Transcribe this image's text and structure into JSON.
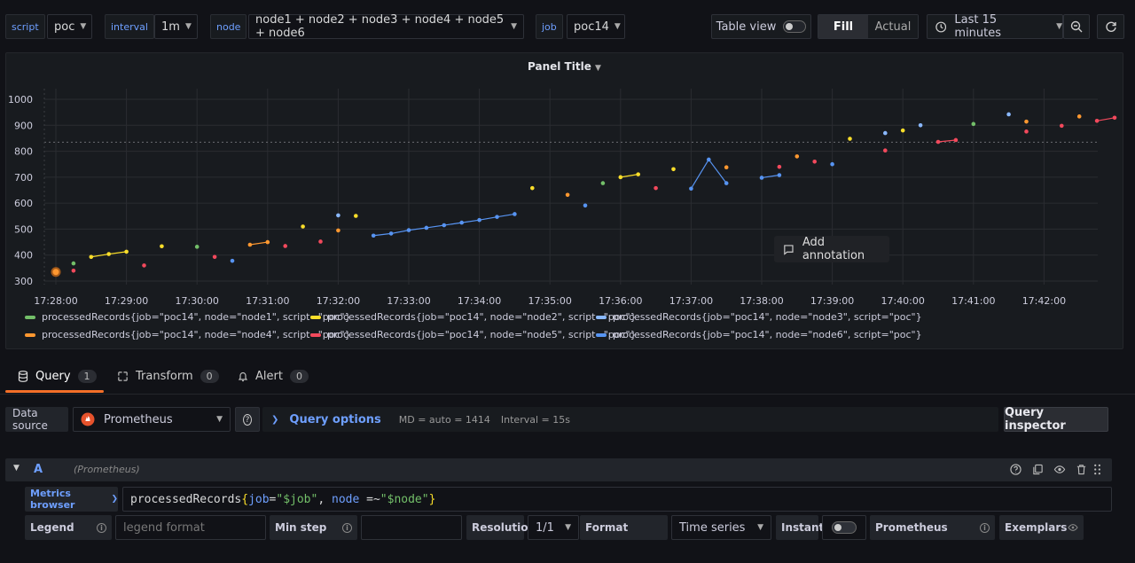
{
  "variables": [
    {
      "label": "script",
      "value": "poc"
    },
    {
      "label": "interval",
      "value": "1m"
    },
    {
      "label": "node",
      "value": "node1 + node2 + node3 + node4 + node5 + node6"
    },
    {
      "label": "job",
      "value": "poc14"
    }
  ],
  "toolbar": {
    "table_view": "Table view",
    "fill": "Fill",
    "actual": "Actual",
    "time_range": "Last 15 minutes"
  },
  "panel": {
    "title": "Panel Title",
    "annotation": "Add annotation"
  },
  "chart_data": {
    "type": "scatter",
    "title": "Panel Title",
    "y_ticks": [
      1000,
      900,
      800,
      700,
      600,
      500,
      400,
      300
    ],
    "ylim": [
      290,
      1010
    ],
    "x_ticks": [
      "17:28:00",
      "17:29:00",
      "17:30:00",
      "17:31:00",
      "17:32:00",
      "17:33:00",
      "17:34:00",
      "17:35:00",
      "17:36:00",
      "17:37:00",
      "17:38:00",
      "17:39:00",
      "17:40:00",
      "17:41:00",
      "17:42:00"
    ],
    "threshold": 835,
    "series": [
      {
        "name": "processedRecords{job=\"poc14\", node=\"node1\", script=\"poc\"}",
        "color": "#73bf69",
        "points": [
          [
            "17:28:15",
            368
          ],
          [
            "17:30:00",
            432
          ],
          [
            "17:35:45",
            677
          ],
          [
            "17:41:00",
            905
          ]
        ]
      },
      {
        "name": "processedRecords{job=\"poc14\", node=\"node2\", script=\"poc\"}",
        "color": "#fade2a",
        "points": [
          [
            "17:28:30",
            393
          ],
          [
            "17:28:45",
            404
          ],
          [
            "17:29:00",
            413
          ],
          [
            "17:29:30",
            434
          ],
          [
            "17:31:30",
            510
          ],
          [
            "17:32:15",
            551
          ],
          [
            "17:34:45",
            658
          ],
          [
            "17:36:00",
            700
          ],
          [
            "17:36:15",
            711
          ],
          [
            "17:36:45",
            731
          ],
          [
            "17:39:15",
            848
          ],
          [
            "17:40:00",
            880
          ]
        ]
      },
      {
        "name": "processedRecords{job=\"poc14\", node=\"node3\", script=\"poc\"}",
        "color": "#8ab8ff",
        "points": [
          [
            "17:32:00",
            553
          ],
          [
            "17:39:45",
            870
          ],
          [
            "17:40:15",
            900
          ],
          [
            "17:41:30",
            942
          ]
        ]
      },
      {
        "name": "processedRecords{job=\"poc14\", node=\"node4\", script=\"poc\"}",
        "color": "#ff9830",
        "points": [
          [
            "17:28:00",
            335
          ],
          [
            "17:30:45",
            440
          ],
          [
            "17:31:00",
            450
          ],
          [
            "17:32:00",
            495
          ],
          [
            "17:35:15",
            632
          ],
          [
            "17:37:30",
            738
          ],
          [
            "17:38:30",
            780
          ],
          [
            "17:41:45",
            914
          ],
          [
            "17:42:30",
            934
          ]
        ]
      },
      {
        "name": "processedRecords{job=\"poc14\", node=\"node5\", script=\"poc\"}",
        "color": "#f2495c",
        "points": [
          [
            "17:28:15",
            340
          ],
          [
            "17:29:15",
            360
          ],
          [
            "17:30:15",
            393
          ],
          [
            "17:31:15",
            435
          ],
          [
            "17:31:45",
            452
          ],
          [
            "17:36:30",
            658
          ],
          [
            "17:38:15",
            740
          ],
          [
            "17:38:45",
            760
          ],
          [
            "17:39:45",
            803
          ],
          [
            "17:40:30",
            836
          ],
          [
            "17:40:45",
            843
          ],
          [
            "17:41:45",
            876
          ],
          [
            "17:42:15",
            898
          ],
          [
            "17:42:45",
            917
          ],
          [
            "17:43:00",
            929
          ]
        ]
      },
      {
        "name": "processedRecords{job=\"poc14\", node=\"node6\", script=\"poc\"}",
        "color": "#5794f2",
        "points": [
          [
            "17:30:30",
            378
          ],
          [
            "17:32:30",
            475
          ],
          [
            "17:32:45",
            483
          ],
          [
            "17:33:00",
            496
          ],
          [
            "17:33:15",
            505
          ],
          [
            "17:33:30",
            515
          ],
          [
            "17:33:45",
            525
          ],
          [
            "17:34:00",
            535
          ],
          [
            "17:34:15",
            547
          ],
          [
            "17:34:30",
            558
          ],
          [
            "17:35:30",
            591
          ],
          [
            "17:37:00",
            656
          ],
          [
            "17:37:15",
            768
          ],
          [
            "17:37:30",
            677
          ],
          [
            "17:38:00",
            698
          ],
          [
            "17:38:15",
            708
          ],
          [
            "17:39:00",
            750
          ]
        ]
      }
    ]
  },
  "tabs": [
    {
      "label": "Query",
      "count": "1"
    },
    {
      "label": "Transform",
      "count": "0"
    },
    {
      "label": "Alert",
      "count": "0"
    }
  ],
  "editor": {
    "data_source_label": "Data source",
    "data_source": "Prometheus",
    "query_options": "Query options",
    "md": "MD = auto = 1414",
    "interval": "Interval = 15s",
    "inspector": "Query inspector",
    "query_letter": "A",
    "query_source": "(Prometheus)",
    "metrics_browser": "Metrics browser",
    "query_metric": "processedRecords",
    "query_job_key": "job",
    "query_job_val": "\"$job\"",
    "query_node_key": "node",
    "query_node_val": "\"$node\"",
    "legend": "Legend",
    "legend_placeholder": "legend format",
    "min_step": "Min step",
    "resolution": "Resolution",
    "resolution_value": "1/1",
    "format": "Format",
    "format_value": "Time series",
    "instant": "Instant",
    "prometheus": "Prometheus",
    "exemplars": "Exemplars"
  }
}
